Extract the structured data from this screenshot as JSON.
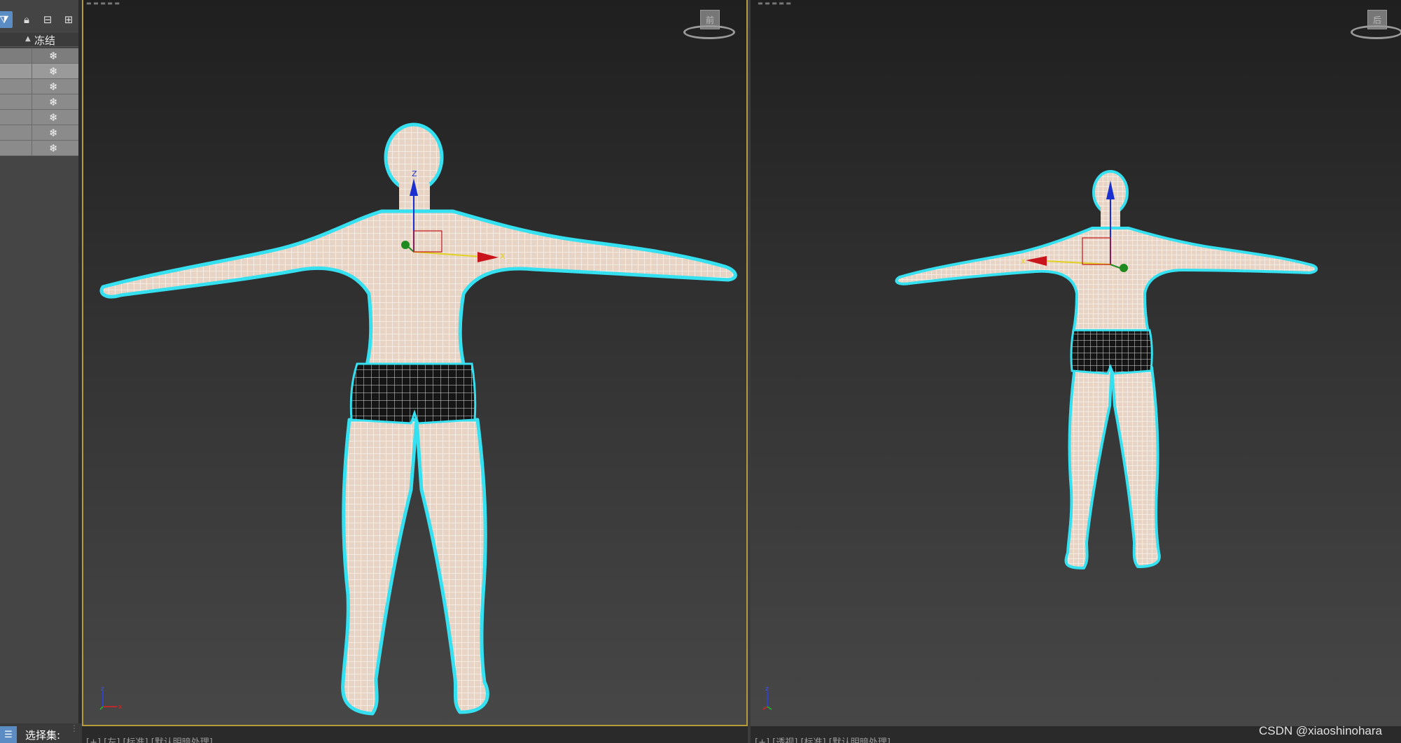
{
  "explorer": {
    "toolbar_icons": [
      "filter-icon",
      "lock-icon",
      "hierarchy-icon",
      "hierarchy-alt-icon"
    ],
    "column_header": "冻结",
    "sort_arrow": "▲",
    "rows": [
      {
        "freeze_glyph": "❄"
      },
      {
        "freeze_glyph": "❄"
      },
      {
        "freeze_glyph": "❄"
      },
      {
        "freeze_glyph": "❄"
      },
      {
        "freeze_glyph": "❄"
      },
      {
        "freeze_glyph": "❄"
      },
      {
        "freeze_glyph": "❄"
      }
    ],
    "selection_set_label": "选择集:"
  },
  "viewport_front": {
    "label": "[+] [左] [标准] [默认明暗处理]",
    "viewcube_face": "前"
  },
  "viewport_persp": {
    "label": "[+] [透视] [标准] [默认明暗处理]",
    "viewcube_face": "后"
  },
  "watermark": "CSDN @xiaoshinohara",
  "colors": {
    "active_border": "#b59c3a",
    "selection_outline": "#35e0f0",
    "skin": "#e8d4c4",
    "shorts": "#151515",
    "axis_x": "#c8141a",
    "axis_y": "#1f8a1f",
    "axis_z": "#1b2fd0"
  }
}
